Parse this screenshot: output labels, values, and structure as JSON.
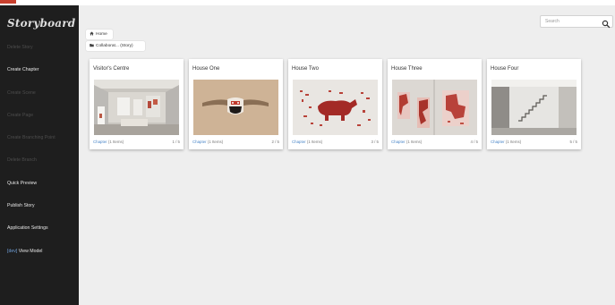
{
  "app": {
    "logo": "Storyboard"
  },
  "sidebar": {
    "items": [
      {
        "label": "Delete Story",
        "enabled": false
      },
      {
        "label": "Create Chapter",
        "enabled": true
      },
      {
        "label": "Create Scene",
        "enabled": false
      },
      {
        "label": "Create Page",
        "enabled": false
      },
      {
        "label": "Create Branching Point",
        "enabled": false
      },
      {
        "label": "Delete Branch",
        "enabled": false
      },
      {
        "label": "Quick Preview",
        "enabled": true
      },
      {
        "label": "Publish Story",
        "enabled": true
      },
      {
        "label": "Application Settings",
        "enabled": true
      },
      {
        "label": "View Model",
        "accent": "[dev]",
        "enabled": true
      }
    ]
  },
  "search": {
    "placeholder": "Search",
    "icon": "search-icon"
  },
  "breadcrumb": {
    "home": {
      "label": "Home",
      "icon": "home-icon"
    },
    "story": {
      "label": "Collaborat... (Story)",
      "icon": "folder-icon"
    }
  },
  "cards": [
    {
      "title": "Visitor's Centre",
      "footer_label": "Chapter",
      "footer_count": "(1 Items)",
      "index": "1 / 5"
    },
    {
      "title": "House One",
      "footer_label": "Chapter",
      "footer_count": "(1 Items)",
      "index": "2 / 5"
    },
    {
      "title": "House Two",
      "footer_label": "Chapter",
      "footer_count": "(1 Items)",
      "index": "3 / 5"
    },
    {
      "title": "House Three",
      "footer_label": "Chapter",
      "footer_count": "(1 Items)",
      "index": "4 / 5"
    },
    {
      "title": "House Four",
      "footer_label": "Chapter",
      "footer_count": "(1 Items)",
      "index": "5 / 5"
    }
  ],
  "colors": {
    "sidebar": "#1e1e1e",
    "background": "#eeeeee",
    "link": "#4a86c8",
    "top_accent": "#c8402e"
  }
}
